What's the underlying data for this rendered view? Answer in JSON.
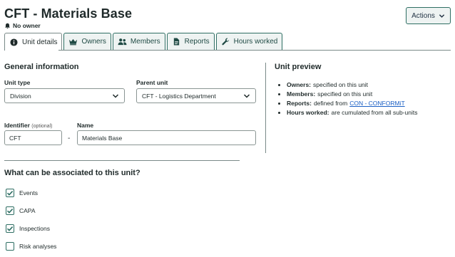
{
  "header": {
    "title": "CFT - Materials Base",
    "owner_status": "No owner",
    "actions_label": "Actions"
  },
  "tabs": [
    {
      "label": "Unit details",
      "icon": "info-icon",
      "active": true
    },
    {
      "label": "Owners",
      "icon": "crown-icon",
      "active": false
    },
    {
      "label": "Members",
      "icon": "users-icon",
      "active": false
    },
    {
      "label": "Reports",
      "icon": "document-icon",
      "active": false
    },
    {
      "label": "Hours worked",
      "icon": "wrench-icon",
      "active": false
    }
  ],
  "general": {
    "title": "General information",
    "unit_type_label": "Unit type",
    "unit_type_value": "Division",
    "parent_unit_label": "Parent unit",
    "parent_unit_value": "CFT - Logistics Department",
    "identifier_label": "Identifier",
    "identifier_optional": "(optional)",
    "identifier_value": "CFT",
    "separator": "-",
    "name_label": "Name",
    "name_value": "Materials Base"
  },
  "preview": {
    "title": "Unit preview",
    "items": [
      {
        "key": "Owners:",
        "text": "specified on this unit",
        "link": ""
      },
      {
        "key": "Members:",
        "text": "specified on this unit",
        "link": ""
      },
      {
        "key": "Reports:",
        "text": "defined from",
        "link": "CON - CONFORMiT"
      },
      {
        "key": "Hours worked:",
        "text": "are cumulated from all sub-units",
        "link": ""
      }
    ]
  },
  "associations": {
    "title": "What can be associated to this unit?",
    "items": [
      {
        "label": "Events",
        "checked": true
      },
      {
        "label": "CAPA",
        "checked": true
      },
      {
        "label": "Inspections",
        "checked": true
      },
      {
        "label": "Risk analyses",
        "checked": false
      }
    ]
  },
  "colors": {
    "accent": "#2e6e63",
    "tab_bg": "#eef3f2",
    "link": "#1a5fc4"
  }
}
